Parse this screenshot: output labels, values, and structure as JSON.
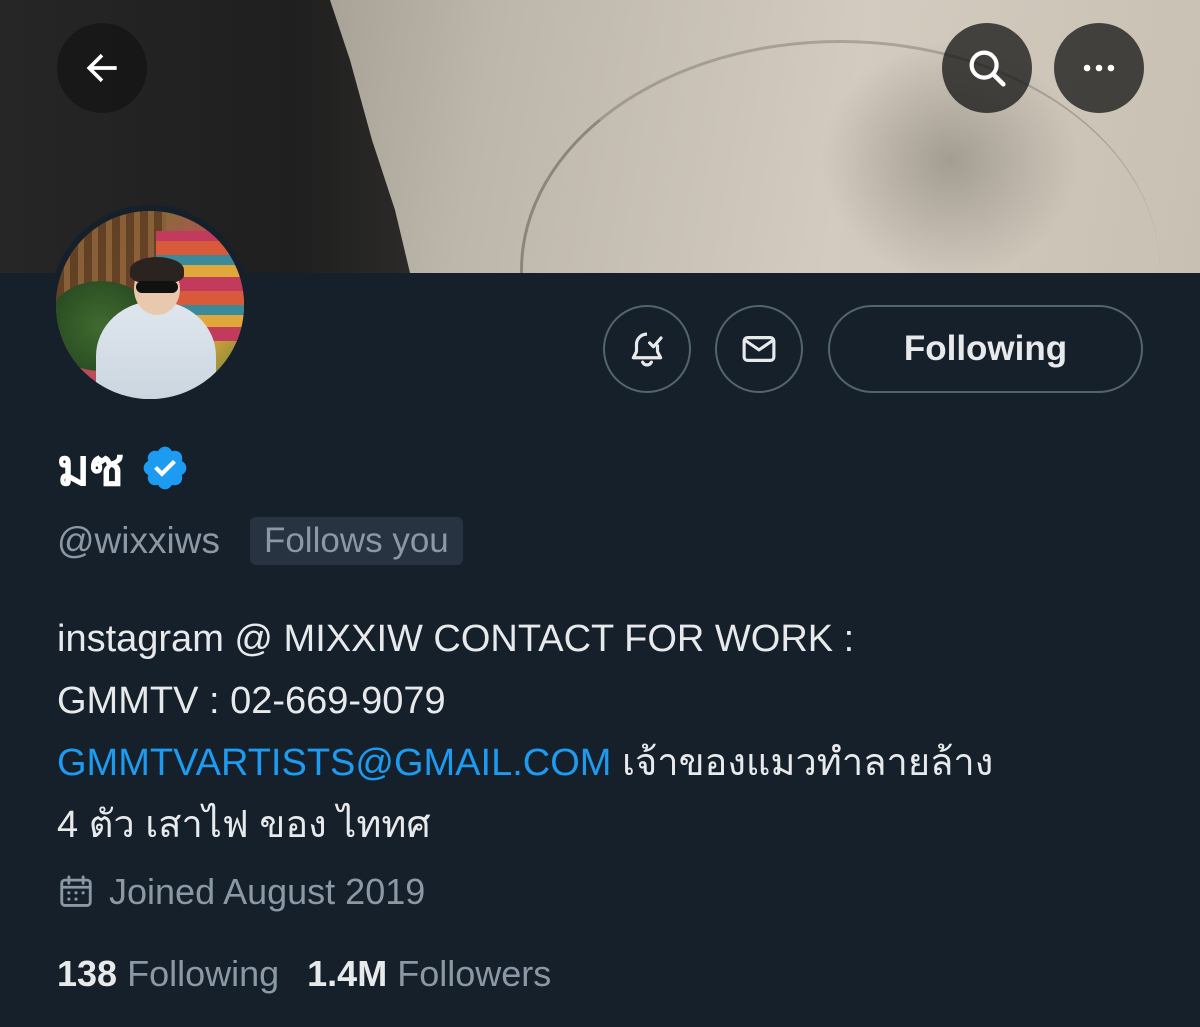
{
  "header": {
    "back_icon": "arrow-left-icon",
    "search_icon": "search-icon",
    "more_icon": "more-horizontal-icon"
  },
  "profile": {
    "display_name": "มซ",
    "verified": true,
    "handle": "@wixxiws",
    "follows_you_label": "Follows you",
    "actions": {
      "notifications_icon": "bell-check-icon",
      "message_icon": "envelope-icon",
      "following_label": "Following"
    },
    "bio": {
      "text_part1": "instagram @ MIXXIW CONTACT FOR WORK :",
      "text_part2": "GMMTV : 02-669-9079",
      "email_link": "GMMTVARTISTS@GMAIL.COM",
      "text_part3": " เจ้าของแมวทำลายล้าง",
      "text_part4": "4 ตัว เสาไฟ ของ ไททศ"
    },
    "joined": "Joined August 2019",
    "joined_icon": "calendar-icon",
    "stats": {
      "following_count": "138",
      "following_label": "Following",
      "followers_count": "1.4M",
      "followers_label": "Followers"
    }
  },
  "colors": {
    "background": "#15202b",
    "accent": "#1d9bf0",
    "secondary_text": "#8b98a5",
    "border": "#536471"
  }
}
